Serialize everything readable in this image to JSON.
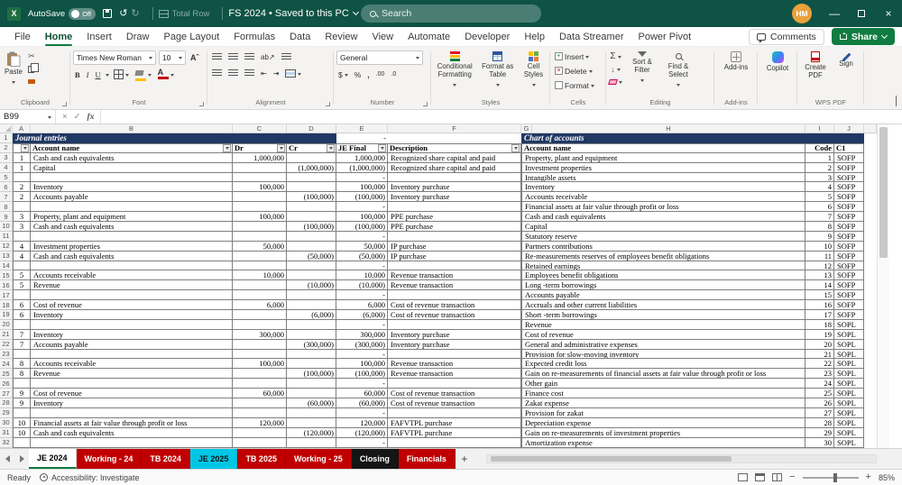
{
  "titlebar": {
    "app_initial": "X",
    "autosave_label": "AutoSave",
    "autosave_state": "Off",
    "total_row_label": "Total Row",
    "doc_title": "FS 2024 • Saved to this PC",
    "search_placeholder": "Search",
    "avatar_initials": "HM"
  },
  "menubar": {
    "items": [
      "File",
      "Home",
      "Insert",
      "Draw",
      "Page Layout",
      "Formulas",
      "Data",
      "Review",
      "View",
      "Automate",
      "Developer",
      "Help",
      "Data Streamer",
      "Power Pivot"
    ],
    "active_item": "Home",
    "comments_label": "Comments",
    "share_label": "Share"
  },
  "ribbon": {
    "clipboard": {
      "label": "Clipboard",
      "paste_label": "Paste"
    },
    "font": {
      "label": "Font",
      "font_name": "Times New Roman",
      "font_size": "10"
    },
    "alignment": {
      "label": "Alignment"
    },
    "number": {
      "label": "Number",
      "format": "General"
    },
    "styles": {
      "label": "Styles",
      "conditional": "Conditional Formatting",
      "format_table": "Format as Table",
      "cell_styles": "Cell Styles"
    },
    "cells": {
      "label": "Cells",
      "insert": "Insert",
      "delete": "Delete",
      "format": "Format"
    },
    "editing": {
      "label": "Editing",
      "sort_filter": "Sort & Filter",
      "find_select": "Find & Select"
    },
    "addins": {
      "label": "Add-ins",
      "button": "Add-ins"
    },
    "copilot": {
      "button": "Copilot"
    },
    "wps": {
      "label": "WPS PDF",
      "create_pdf": "Create PDF",
      "sign": "Sign"
    }
  },
  "formula_bar": {
    "name_box": "B99",
    "fx_label": "fx"
  },
  "grid": {
    "column_letters": [
      "A",
      "B",
      "C",
      "D",
      "E",
      "F",
      "G",
      "H",
      "I",
      "J"
    ],
    "row_count": 32,
    "journal": {
      "title": "Journal entries",
      "title_total": "-",
      "headers": {
        "account": "Account name",
        "dr": "Dr",
        "cr": "Cr",
        "final": "JE Final",
        "desc": "Description"
      },
      "rows": [
        {
          "je": "1",
          "account": "Cash and cash equivalents",
          "dr": "1,000,000",
          "cr": "",
          "final": "1,000,000",
          "desc": "Recognized share capital and paid"
        },
        {
          "je": "1",
          "account": "Capital",
          "dr": "",
          "cr": "(1,000,000)",
          "final": "(1,000,000)",
          "desc": "Recognized share capital and paid"
        },
        {
          "je": "",
          "account": "",
          "dr": "",
          "cr": "",
          "final": "-",
          "desc": ""
        },
        {
          "je": "2",
          "account": "Inventory",
          "dr": "100,000",
          "cr": "",
          "final": "100,000",
          "desc": "Inventory purchase"
        },
        {
          "je": "2",
          "account": "Accounts payable",
          "dr": "",
          "cr": "(100,000)",
          "final": "(100,000)",
          "desc": "Inventory purchase"
        },
        {
          "je": "",
          "account": "",
          "dr": "",
          "cr": "",
          "final": "-",
          "desc": ""
        },
        {
          "je": "3",
          "account": "Property, plant and equipment",
          "dr": "100,000",
          "cr": "",
          "final": "100,000",
          "desc": "PPE purchase"
        },
        {
          "je": "3",
          "account": "Cash and cash equivalents",
          "dr": "",
          "cr": "(100,000)",
          "final": "(100,000)",
          "desc": "PPE purchase"
        },
        {
          "je": "",
          "account": "",
          "dr": "",
          "cr": "",
          "final": "-",
          "desc": ""
        },
        {
          "je": "4",
          "account": "Investment properties",
          "dr": "50,000",
          "cr": "",
          "final": "50,000",
          "desc": "IP purchase"
        },
        {
          "je": "4",
          "account": "Cash and cash equivalents",
          "dr": "",
          "cr": "(50,000)",
          "final": "(50,000)",
          "desc": "IP purchase"
        },
        {
          "je": "",
          "account": "",
          "dr": "",
          "cr": "",
          "final": "-",
          "desc": ""
        },
        {
          "je": "5",
          "account": "Accounts receivable",
          "dr": "10,000",
          "cr": "",
          "final": "10,000",
          "desc": "Revenue transaction"
        },
        {
          "je": "5",
          "account": "Revenue",
          "dr": "",
          "cr": "(10,000)",
          "final": "(10,000)",
          "desc": "Revenue transaction"
        },
        {
          "je": "",
          "account": "",
          "dr": "",
          "cr": "",
          "final": "-",
          "desc": ""
        },
        {
          "je": "6",
          "account": "Cost of revenue",
          "dr": "6,000",
          "cr": "",
          "final": "6,000",
          "desc": "Cost of revenue transaction"
        },
        {
          "je": "6",
          "account": "Inventory",
          "dr": "",
          "cr": "(6,000)",
          "final": "(6,000)",
          "desc": "Cost of revenue transaction"
        },
        {
          "je": "",
          "account": "",
          "dr": "",
          "cr": "",
          "final": "-",
          "desc": ""
        },
        {
          "je": "7",
          "account": "Inventory",
          "dr": "300,000",
          "cr": "",
          "final": "300,000",
          "desc": "Inventory purchase"
        },
        {
          "je": "7",
          "account": "Accounts payable",
          "dr": "",
          "cr": "(300,000)",
          "final": "(300,000)",
          "desc": "Inventory purchase"
        },
        {
          "je": "",
          "account": "",
          "dr": "",
          "cr": "",
          "final": "-",
          "desc": ""
        },
        {
          "je": "8",
          "account": "Accounts receivable",
          "dr": "100,000",
          "cr": "",
          "final": "100,000",
          "desc": "Revenue transaction"
        },
        {
          "je": "8",
          "account": "Revenue",
          "dr": "",
          "cr": "(100,000)",
          "final": "(100,000)",
          "desc": "Revenue transaction"
        },
        {
          "je": "",
          "account": "",
          "dr": "",
          "cr": "",
          "final": "-",
          "desc": ""
        },
        {
          "je": "9",
          "account": "Cost of revenue",
          "dr": "60,000",
          "cr": "",
          "final": "60,000",
          "desc": "Cost of revenue transaction"
        },
        {
          "je": "9",
          "account": "Inventory",
          "dr": "",
          "cr": "(60,000)",
          "final": "(60,000)",
          "desc": "Cost of revenue transaction"
        },
        {
          "je": "",
          "account": "",
          "dr": "",
          "cr": "",
          "final": "-",
          "desc": ""
        },
        {
          "je": "10",
          "account": "Financial assets at fair value through profit or loss",
          "dr": "120,000",
          "cr": "",
          "final": "120,000",
          "desc": "FAFVTPL purchase"
        },
        {
          "je": "10",
          "account": "Cash and cash equivalents",
          "dr": "",
          "cr": "(120,000)",
          "final": "(120,000)",
          "desc": "FAFVTPL purchase"
        },
        {
          "je": "",
          "account": "",
          "dr": "",
          "cr": "",
          "final": "-",
          "desc": ""
        }
      ]
    },
    "coa": {
      "title": "Chart of accounts",
      "headers": {
        "account": "Account name",
        "code": "Code",
        "c1": "C1"
      },
      "rows": [
        {
          "account": "Property, plant and equipment",
          "code": "1",
          "c1": "SOFP"
        },
        {
          "account": "Investment properties",
          "code": "2",
          "c1": "SOFP"
        },
        {
          "account": "Intangible assets",
          "code": "3",
          "c1": "SOFP"
        },
        {
          "account": "Inventory",
          "code": "4",
          "c1": "SOFP"
        },
        {
          "account": "Accounts receivable",
          "code": "5",
          "c1": "SOFP"
        },
        {
          "account": "Financial assets at fair value through profit or loss",
          "code": "6",
          "c1": "SOFP"
        },
        {
          "account": "Cash and cash equivalents",
          "code": "7",
          "c1": "SOFP"
        },
        {
          "account": "Capital",
          "code": "8",
          "c1": "SOFP"
        },
        {
          "account": "Statutory reserve",
          "code": "9",
          "c1": "SOFP"
        },
        {
          "account": "Partners contributions",
          "code": "10",
          "c1": "SOFP"
        },
        {
          "account": "Re-measurements reserves of employees benefit obligations",
          "code": "11",
          "c1": "SOFP"
        },
        {
          "account": "Retained earnings",
          "code": "12",
          "c1": "SOFP"
        },
        {
          "account": "Employees benefit obligations",
          "code": "13",
          "c1": "SOFP"
        },
        {
          "account": "Long -term borrowings",
          "code": "14",
          "c1": "SOFP"
        },
        {
          "account": "Accounts payable",
          "code": "15",
          "c1": "SOFP"
        },
        {
          "account": "Accruals and other current liabilities",
          "code": "16",
          "c1": "SOFP"
        },
        {
          "account": "Short -term borrowings",
          "code": "17",
          "c1": "SOFP"
        },
        {
          "account": "Revenue",
          "code": "18",
          "c1": "SOPL"
        },
        {
          "account": "Cost of revenue",
          "code": "19",
          "c1": "SOPL"
        },
        {
          "account": "General and administrative expenses",
          "code": "20",
          "c1": "SOPL"
        },
        {
          "account": "Provision for slow-moving inventory",
          "code": "21",
          "c1": "SOPL"
        },
        {
          "account": "Expected credit loss",
          "code": "22",
          "c1": "SOPL"
        },
        {
          "account": "Gain on re-measurements of financial assets at fair value through profit or loss",
          "code": "23",
          "c1": "SOPL"
        },
        {
          "account": "Other gain",
          "code": "24",
          "c1": "SOPL"
        },
        {
          "account": "Finance cost",
          "code": "25",
          "c1": "SOPL"
        },
        {
          "account": "Zakat expense",
          "code": "26",
          "c1": "SOPL"
        },
        {
          "account": "Provision for zakat",
          "code": "27",
          "c1": "SOPL"
        },
        {
          "account": "Depreciation expense",
          "code": "28",
          "c1": "SOPL"
        },
        {
          "account": "Gain on re-measurements of investment properties",
          "code": "29",
          "c1": "SOPL"
        },
        {
          "account": "Amortization expense",
          "code": "30",
          "c1": "SOPL"
        }
      ]
    }
  },
  "sheet_tabs": {
    "tabs": [
      {
        "label": "JE 2024",
        "state": "active"
      },
      {
        "label": "Working - 24",
        "state": "red"
      },
      {
        "label": "TB 2024",
        "state": "red"
      },
      {
        "label": "JE 2025",
        "state": "cyan"
      },
      {
        "label": "TB 2025",
        "state": "red"
      },
      {
        "label": "Working - 25",
        "state": "red"
      },
      {
        "label": "Closing",
        "state": "black"
      },
      {
        "label": "Financials",
        "state": "red"
      }
    ]
  },
  "statusbar": {
    "ready": "Ready",
    "accessibility": "Accessibility: Investigate",
    "zoom": "85%"
  },
  "colors": {
    "titlebar": "#0E5346",
    "accent_green": "#107C41",
    "banner_blue": "#1F3864",
    "tab_red": "#C00000",
    "tab_cyan": "#00C7E6",
    "tab_black": "#151515",
    "avatar_orange": "#E9A13B"
  }
}
